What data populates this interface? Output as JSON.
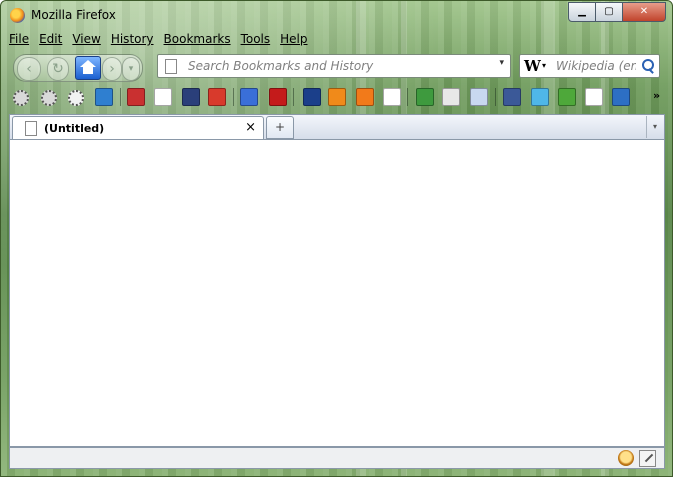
{
  "window": {
    "title": "Mozilla Firefox"
  },
  "caption_buttons": {
    "minimize": "▁",
    "maximize": "▢",
    "close": "✕"
  },
  "menu": {
    "items": [
      {
        "label": "File"
      },
      {
        "label": "Edit"
      },
      {
        "label": "View"
      },
      {
        "label": "History"
      },
      {
        "label": "Bookmarks"
      },
      {
        "label": "Tools"
      },
      {
        "label": "Help"
      }
    ]
  },
  "navigation": {
    "back_icon": "back-arrow-icon",
    "reload_icon": "reload-icon",
    "home_icon": "home-icon",
    "forward_icon": "forward-arrow-icon",
    "history_dropdown": "▾"
  },
  "urlbar": {
    "placeholder": "Search Bookmarks and History",
    "value": "",
    "dropdown": "▾"
  },
  "searchbar": {
    "engine": "W",
    "engine_dropdown": "▾",
    "placeholder": "Wikipedia (en)",
    "value": ""
  },
  "bookmarks": {
    "icons": [
      {
        "name": "gear-icon",
        "color": "#d9d9d9"
      },
      {
        "name": "gear-icon",
        "color": "#d9d9d9"
      },
      {
        "name": "gear-icon",
        "color": "#f2f2f2"
      },
      {
        "name": "bookmark-icon",
        "color": "#2f7fd0"
      },
      {
        "name": "sk-icon",
        "color": "#c93030"
      },
      {
        "name": "page-icon",
        "color": "#ffffff"
      },
      {
        "name": "camera-icon",
        "color": "#2a3f7a"
      },
      {
        "name": "shield-icon",
        "color": "#d83a2c"
      },
      {
        "name": "google-icon",
        "color": "#3a6fd8"
      },
      {
        "name": "youtube-icon",
        "color": "#c41b1b"
      },
      {
        "name": "moon-icon",
        "color": "#1b3f8a"
      },
      {
        "name": "magnet-icon",
        "color": "#f08a1a"
      },
      {
        "name": "rss-icon",
        "color": "#f27a1a"
      },
      {
        "name": "page-icon",
        "color": "#ffffff"
      },
      {
        "name": "tree-icon",
        "color": "#3e9a3e"
      },
      {
        "name": "notepad-icon",
        "color": "#e8e8e8"
      },
      {
        "name": "book-icon",
        "color": "#c8d8f0"
      },
      {
        "name": "facebook-icon",
        "color": "#3b5998"
      },
      {
        "name": "twitter-icon",
        "color": "#4fb7e8"
      },
      {
        "name": "puzzle-icon",
        "color": "#4ea83a"
      },
      {
        "name": "page-icon",
        "color": "#ffffff"
      },
      {
        "name": "screenshot-icon",
        "color": "#2d6fc4"
      }
    ],
    "overflow": "»"
  },
  "tabs": [
    {
      "title": "(Untitled)",
      "close": "×"
    }
  ],
  "new_tab": "+",
  "tab_list": "▾"
}
